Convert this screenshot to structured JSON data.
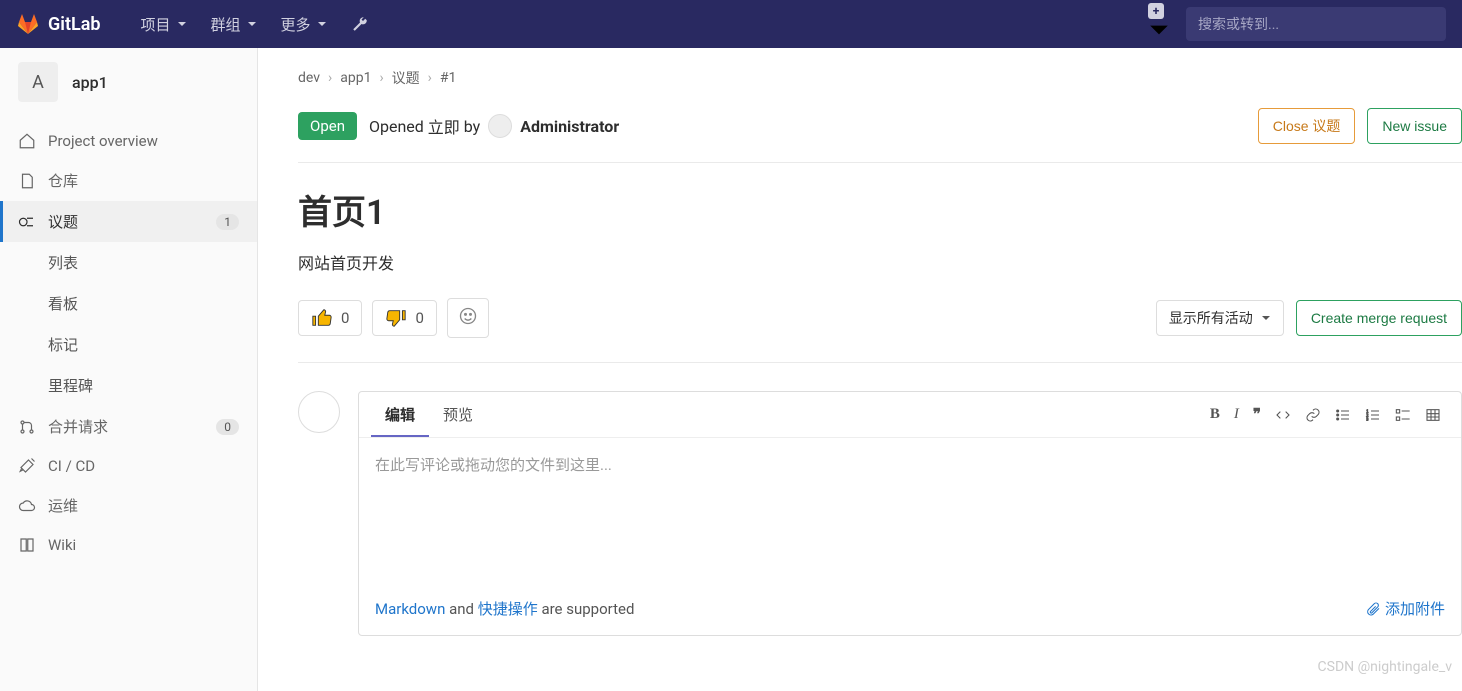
{
  "topnav": {
    "brand": "GitLab",
    "items": [
      "项目",
      "群组",
      "更多"
    ],
    "plus_label": "+",
    "search_placeholder": "搜索或转到..."
  },
  "sidebar": {
    "project_avatar_letter": "A",
    "project_name": "app1",
    "items": [
      {
        "label": "Project overview",
        "icon": "home-icon"
      },
      {
        "label": "仓库",
        "icon": "file-icon"
      },
      {
        "label": "议题",
        "icon": "issues-icon",
        "badge": "1",
        "active": true,
        "subs": [
          "列表",
          "看板",
          "标记",
          "里程碑"
        ]
      },
      {
        "label": "合并请求",
        "icon": "merge-icon",
        "badge": "0"
      },
      {
        "label": "CI / CD",
        "icon": "rocket-icon"
      },
      {
        "label": "运维",
        "icon": "cloud-icon"
      },
      {
        "label": "Wiki",
        "icon": "book-icon"
      }
    ]
  },
  "breadcrumbs": [
    "dev",
    "app1",
    "议题",
    "#1"
  ],
  "issue": {
    "state": "Open",
    "opened_prefix": "Opened",
    "opened_time": "立即",
    "opened_by": "by",
    "author": "Administrator",
    "close_btn": "Close 议题",
    "new_btn": "New issue",
    "title": "首页1",
    "description": "网站首页开发"
  },
  "reactions": {
    "thumbs_up": "0",
    "thumbs_down": "0",
    "activity_filter": "显示所有活动",
    "create_mr": "Create merge request"
  },
  "comment": {
    "tab_edit": "编辑",
    "tab_preview": "预览",
    "placeholder": "在此写评论或拖动您的文件到这里...",
    "md_link": "Markdown",
    "support_mid": " and ",
    "quick_link": "快捷操作",
    "support_suffix": " are supported",
    "attach": "添加附件"
  },
  "watermark": "CSDN @nightingale_v"
}
